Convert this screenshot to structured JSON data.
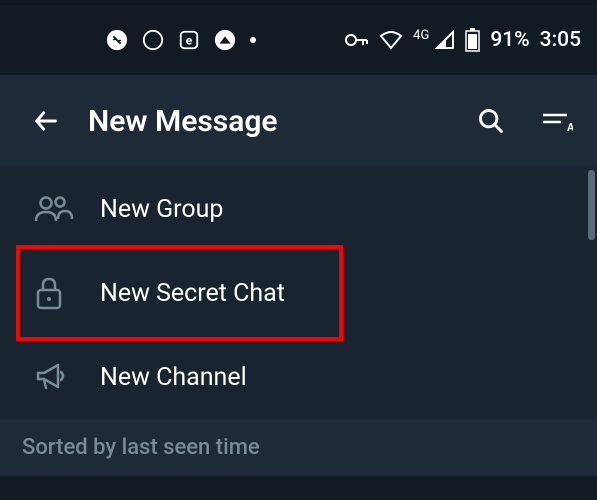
{
  "status_bar": {
    "battery_percent": "91%",
    "time": "3:05",
    "network_type": "4G"
  },
  "app_bar": {
    "title": "New Message"
  },
  "menu": {
    "items": [
      {
        "label": "New Group"
      },
      {
        "label": "New Secret Chat"
      },
      {
        "label": "New Channel"
      }
    ]
  },
  "sort": {
    "label": "Sorted by last seen time"
  }
}
